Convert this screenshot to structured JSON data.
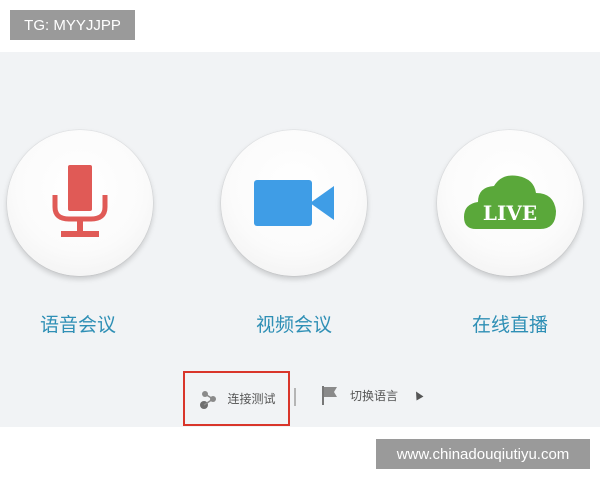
{
  "watermark_top": "TG: MYYJJPP",
  "watermark_bottom": "www.chinadouqiutiyu.com",
  "buttons": [
    {
      "label": "语音会议",
      "icon": "microphone-icon",
      "color": "#e05a56"
    },
    {
      "label": "视频会议",
      "icon": "video-camera-icon",
      "color": "#3f9de6"
    },
    {
      "label": "在线直播",
      "icon": "live-cloud-icon",
      "color": "#5aa83a",
      "icon_text": "LIVE"
    }
  ],
  "bottom": {
    "connection_test_label": "连接测试",
    "switch_language_label": "切换语言"
  },
  "colors": {
    "label": "#2e8fb5",
    "highlight_border": "#d9352a",
    "panel_bg": "#f1f3f5"
  }
}
